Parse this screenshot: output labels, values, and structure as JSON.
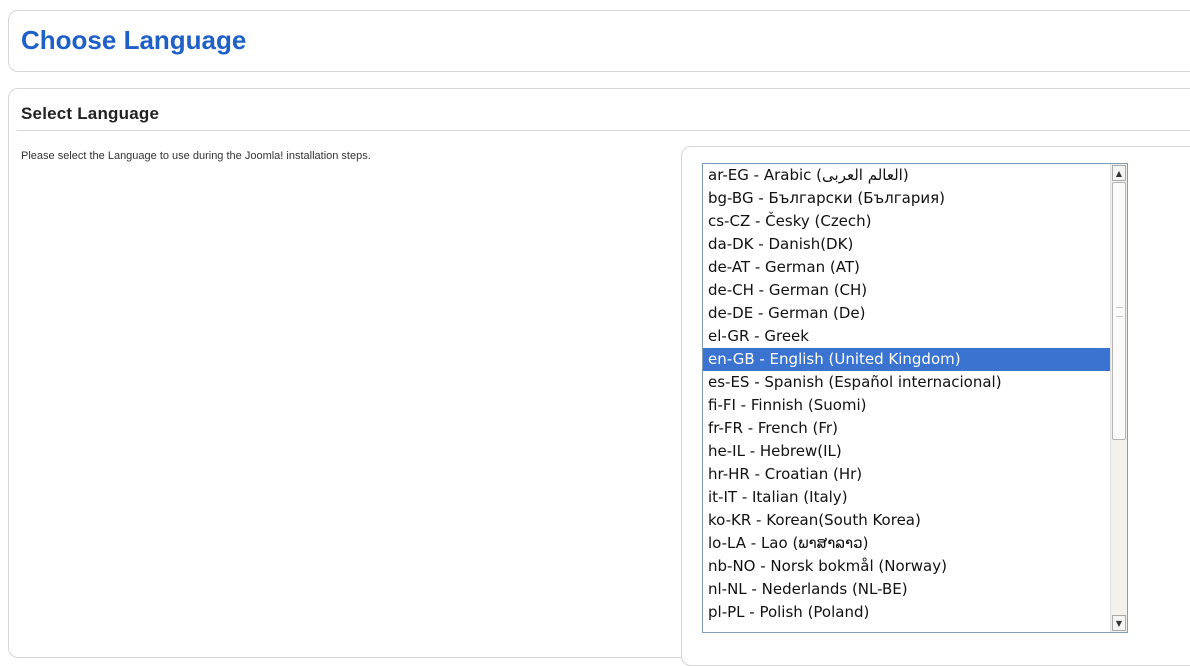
{
  "header": {
    "title": "Choose Language"
  },
  "section": {
    "title": "Select Language",
    "instructions": "Please select the Language to use during the Joomla! installation steps."
  },
  "language_list": {
    "selected": "en-GB - English (United Kingdom)",
    "options": [
      "ar-EG - Arabic (العالم العربى)",
      "bg-BG - Български (България)",
      "cs-CZ - Česky (Czech)",
      "da-DK - Danish(DK)",
      "de-AT - German (AT)",
      "de-CH - German (CH)",
      "de-DE - German (De)",
      "el-GR - Greek",
      "en-GB - English (United Kingdom)",
      "es-ES - Spanish (Español internacional)",
      "fi-FI - Finnish (Suomi)",
      "fr-FR - French (Fr)",
      "he-IL - Hebrew(IL)",
      "hr-HR - Croatian (Hr)",
      "it-IT - Italian (Italy)",
      "ko-KR - Korean(South Korea)",
      "lo-LA - Lao (ພາສາລາວ)",
      "nb-NO - Norsk bokmål (Norway)",
      "nl-NL - Nederlands (NL-BE)",
      "pl-PL - Polish (Poland)"
    ]
  },
  "icons": {
    "scroll_up": "arrow-up-icon",
    "scroll_down": "arrow-down-icon"
  },
  "colors": {
    "title": "#1e60c8",
    "selection": "#3a74d0",
    "border": "#d6d6d6"
  }
}
